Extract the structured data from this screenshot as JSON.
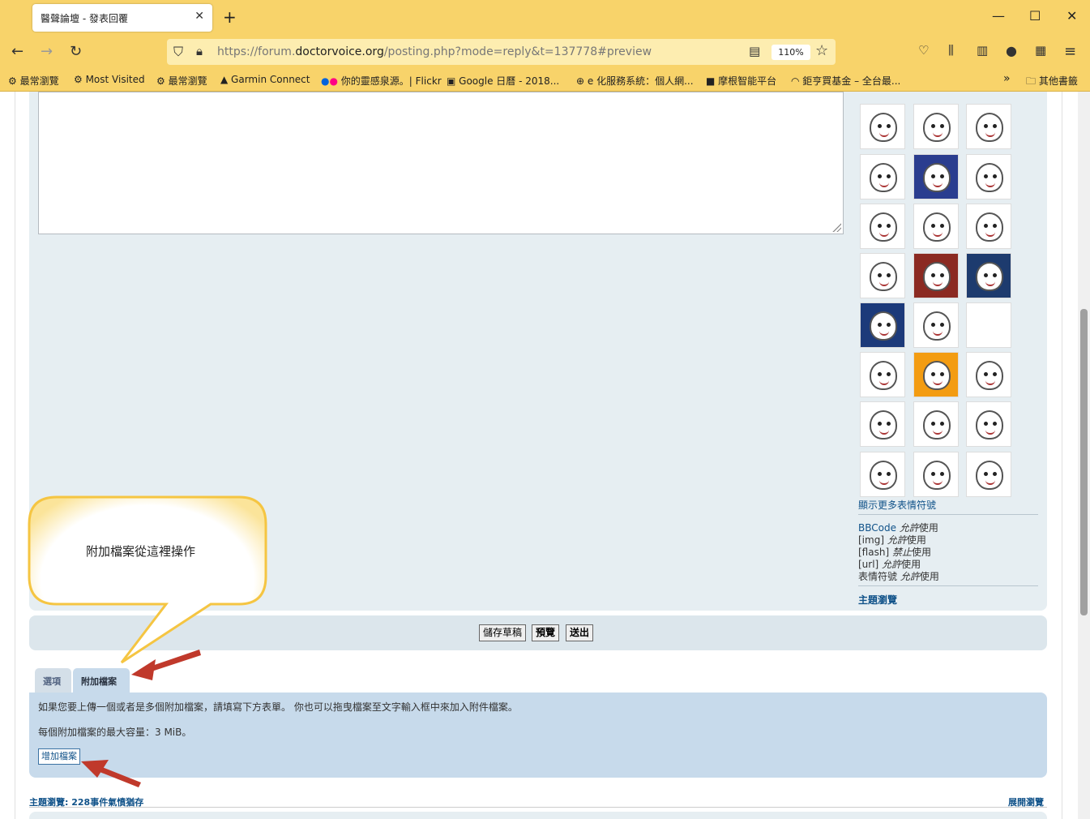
{
  "browser": {
    "tab_title": "醫聲論壇 - 發表回覆",
    "tab_close": "✕",
    "new_tab": "+",
    "url_prefix": "https://forum.",
    "url_domain": "doctorvoice.org",
    "url_path": "/posting.php?mode=reply&t=137778#preview",
    "zoom": "110%",
    "bookmarks": [
      "最常瀏覽",
      "Most Visited",
      "最常瀏覽",
      "Garmin Connect",
      "你的靈感泉源。| Flickr",
      "Google 日曆 - 2018...",
      "e 化服務系統：個人網...",
      "摩根智能平台",
      "鉅亨買基金 – 全台最...",
      "其他書籤"
    ]
  },
  "sidebar": {
    "more_smilies": "顯示更多表情符號",
    "bbcode_label": "BBCode",
    "bbcode_status": "允許",
    "img_label": "[img]",
    "img_status": "允許",
    "flash_label": "[flash]",
    "flash_status": "禁止",
    "url_label": "[url]",
    "url_status": "允許",
    "smilies_label": "表情符號",
    "smilies_status": "允許",
    "use_suffix": "使用",
    "topic_review": "主題瀏覽"
  },
  "buttons": {
    "save_draft": "儲存草稿",
    "preview": "預覽",
    "submit": "送出"
  },
  "tabs": {
    "options": "選項",
    "attachments": "附加檔案"
  },
  "attachments": {
    "instructions": "如果您要上傳一個或者是多個附加檔案，請填寫下方表單。 你也可以拖曳檔案至文字輸入框中來加入附件檔案。",
    "max_size": "每個附加檔案的最大容量：3 MiB。",
    "add_file": "增加檔案"
  },
  "footer": {
    "topic_review": "主題瀏覽: 228事件氣憤猶存",
    "expand_view": "展開瀏覽"
  },
  "callout": {
    "text": "附加檔案從這裡操作"
  }
}
